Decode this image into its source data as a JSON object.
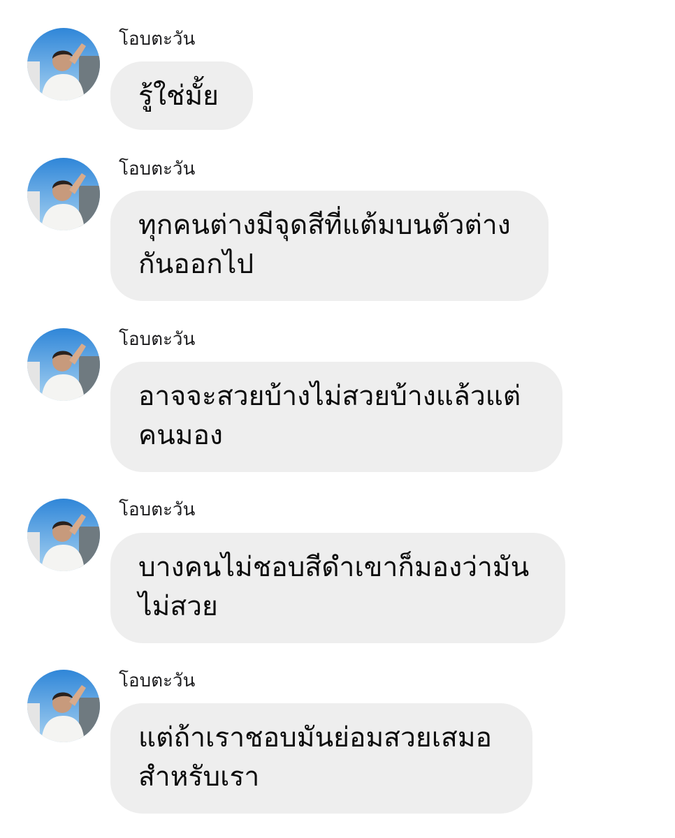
{
  "sender_name": "โอบตะวัน",
  "colors": {
    "bubble_bg": "#eeeeee",
    "text": "#0c0c0c",
    "background": "#ffffff"
  },
  "messages": [
    {
      "avatar": "user-photo-icon",
      "sender": "โอบตะวัน",
      "lines": [
        "รู้ใช่มั้ย"
      ]
    },
    {
      "avatar": "user-photo-icon",
      "sender": "โอบตะวัน",
      "lines": [
        "ทุกคนต่างมีจุดสีที่แต้มบนตัวต่าง",
        "กันออกไป"
      ]
    },
    {
      "avatar": "user-photo-icon",
      "sender": "โอบตะวัน",
      "lines": [
        "อาจจะสวยบ้างไม่สวยบ้างแล้วแต่",
        "คนมอง"
      ]
    },
    {
      "avatar": "user-photo-icon",
      "sender": "โอบตะวัน",
      "lines": [
        "บางคนไม่ชอบสีดำเขาก็มองว่ามัน",
        "ไม่สวย"
      ]
    },
    {
      "avatar": "user-photo-icon",
      "sender": "โอบตะวัน",
      "lines": [
        "แต่ถ้าเราชอบมันย่อมสวยเสมอ",
        "สำหรับเรา"
      ]
    }
  ]
}
